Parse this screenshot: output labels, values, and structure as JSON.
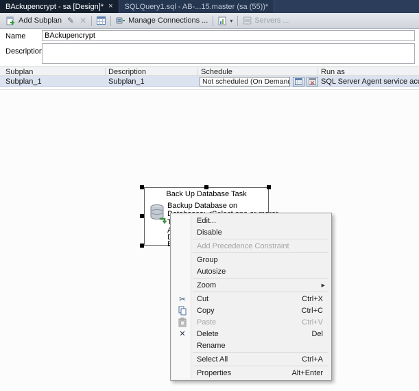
{
  "icons": {
    "close": "×",
    "pencil": "✎",
    "x": "✕",
    "caret": "▾",
    "submenu_arrow": "▶",
    "scissors": "✂",
    "delete_x": "✕",
    "warning": "✕"
  },
  "tabs": [
    {
      "label": "BAckupencrypt - sa [Design]*"
    },
    {
      "label": "SQLQuery1.sql - AB-...15.master (sa (55))*"
    }
  ],
  "toolbar": {
    "add_subplan": "Add Subplan",
    "manage_connections": "Manage Connections ...",
    "servers": "Servers ..."
  },
  "form": {
    "name_label": "Name",
    "name_value": "BAckupencrypt",
    "description_label": "Description",
    "description_value": ""
  },
  "grid": {
    "columns": [
      "Subplan",
      "Description",
      "Schedule",
      "Run as"
    ],
    "rows": [
      {
        "subplan": "Subplan_1",
        "description": "Subplan_1",
        "schedule": "Not scheduled (On Demand)",
        "run_as": "SQL Server Agent service account"
      }
    ]
  },
  "designer": {
    "task_title": "Back Up Database Task",
    "task_line1": "Backup Database on",
    "task_line2": "Databases: <Select one or more>",
    "task_partial_lines": [
      "T",
      "A",
      "D",
      "E"
    ]
  },
  "context_menu": {
    "items": [
      {
        "label": "Edit...",
        "shortcut": ""
      },
      {
        "label": "Disable",
        "shortcut": ""
      },
      {
        "label": "Add Precedence Constraint",
        "shortcut": ""
      },
      {
        "label": "Group",
        "shortcut": ""
      },
      {
        "label": "Autosize",
        "shortcut": ""
      },
      {
        "label": "Zoom",
        "shortcut": ""
      },
      {
        "label": "Cut",
        "shortcut": "Ctrl+X"
      },
      {
        "label": "Copy",
        "shortcut": "Ctrl+C"
      },
      {
        "label": "Paste",
        "shortcut": "Ctrl+V"
      },
      {
        "label": "Delete",
        "shortcut": "Del"
      },
      {
        "label": "Rename",
        "shortcut": ""
      },
      {
        "label": "Select All",
        "shortcut": "Ctrl+A"
      },
      {
        "label": "Properties",
        "shortcut": "Alt+Enter"
      }
    ]
  },
  "colors": {
    "tabbar_bg": "#2b3d5a",
    "active_tab_bg": "#15202f",
    "selected_row_bg": "#dbe3f0",
    "warning_red": "#d42a2a"
  }
}
